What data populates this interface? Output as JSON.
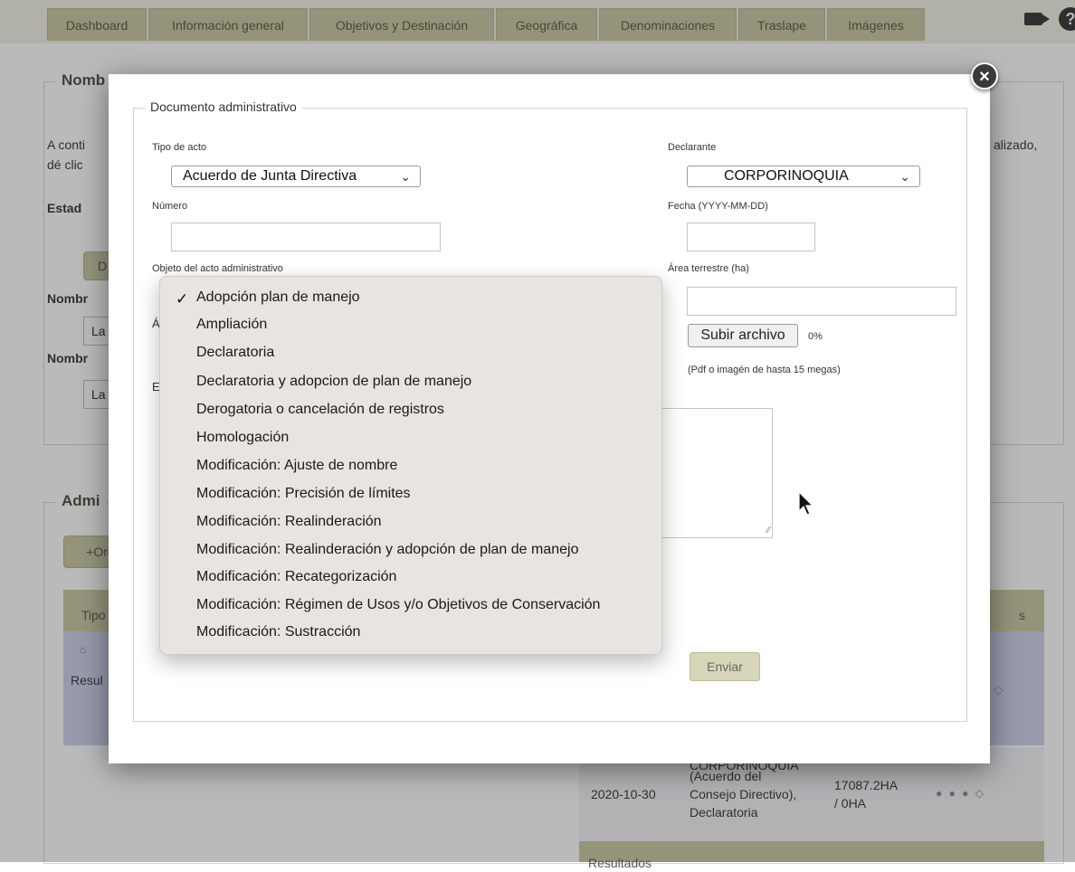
{
  "tabs": [
    "Dashboard",
    "Información general",
    "Objetivos y Destinación",
    "Geográfica",
    "Denominaciones",
    "Traslape",
    "Imágenes"
  ],
  "background": {
    "section1_legend": "Nomb",
    "intro_left": "A conti",
    "intro_left2": "dé clic",
    "intro_right": "alizado,",
    "estado_label": "Estad",
    "button_d": "D",
    "nombre1_label": "Nombr",
    "nombre1_value": "La",
    "nombre2_label": "Nombr",
    "nombre2_value": "La",
    "section2_legend": "Admi",
    "add_button": "+Org",
    "table_tipo": "Tipo",
    "table_s": "s",
    "row_icon": "⌂",
    "results_label": "Resul",
    "bottom_row": {
      "date": "2020-10-30",
      "desc_line0": "CORPORINOQUIA",
      "desc_line1": "(Acuerdo del",
      "desc_line2": "Consejo Directivo),",
      "desc_line3": "Declaratoria",
      "area1": "17087.2HA",
      "area2": "/ 0HA",
      "actions": "● ● ● ◇"
    },
    "footer_results": "Resultados",
    "right_icon_partial": "◇"
  },
  "modal": {
    "legend": "Documento administrativo",
    "tipo_label": "Tipo de acto",
    "tipo_value": "Acuerdo de Junta Directiva",
    "numero_label": "Número",
    "objeto_label": "Objeto del acto administrativo",
    "area_label_partial": "Á",
    "e_label_partial": "E",
    "declarante_label": "Declarante",
    "declarante_value": "CORPORINOQUIA",
    "fecha_label": "Fecha (YYYY-MM-DD)",
    "area_terrestre_label": "Área terrestre (ha)",
    "upload_button": "Subir archivo",
    "upload_progress": "0%",
    "upload_hint": "(Pdf o imagén de hasta 15 megas)",
    "send_button": "Enviar"
  },
  "dropdown": {
    "selected_index": 0,
    "options": [
      "Adopción plan de manejo",
      "Ampliación",
      "Declaratoria",
      "Declaratoria y adopcion de plan de manejo",
      "Derogatoria o cancelación de registros",
      "Homologación",
      "Modificación: Ajuste de nombre",
      "Modificación: Precisión de límites",
      "Modificación: Realinderación",
      "Modificación: Realinderación y adopción de plan de manejo",
      "Modificación: Recategorización",
      "Modificación: Régimen de Usos y/o Objetivos de Conservación",
      "Modificación: Sustracción"
    ]
  },
  "colors": {
    "tab_bg": "#c9c7a3",
    "overlay": "rgba(40,40,40,0.32)",
    "dropdown_bg": "#e8e4e0",
    "row_lavender": "#ccd0ea"
  }
}
